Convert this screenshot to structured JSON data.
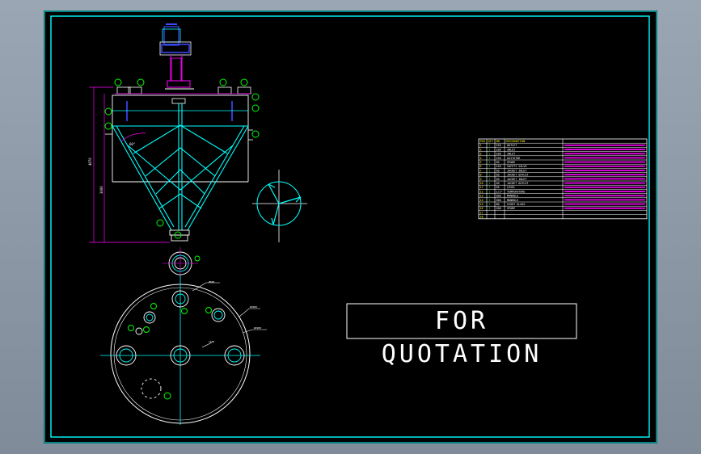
{
  "colors": {
    "background": "#000000",
    "frame": "#00ffff",
    "outline": "#ffffff",
    "magenta": "#ff00ff",
    "green": "#00ff00",
    "yellow": "#ffff00",
    "blue": "#3c4bff"
  },
  "stamp": "FOR QUOTATION",
  "bom": {
    "headers": [
      "POS",
      "QTY",
      "DN",
      "DESIGNATION"
    ],
    "rows": [
      {
        "pos": "1",
        "qty": "1",
        "dn": "250",
        "name": "OUTLET"
      },
      {
        "pos": "2",
        "qty": "1",
        "dn": "100",
        "name": "INLET"
      },
      {
        "pos": "3",
        "qty": "1",
        "dn": "100",
        "name": "INLET"
      },
      {
        "pos": "4",
        "qty": "1",
        "dn": "150",
        "name": "AGITATOR"
      },
      {
        "pos": "5",
        "qty": "1",
        "dn": "50",
        "name": "SPARE"
      },
      {
        "pos": "6",
        "qty": "1",
        "dn": "150",
        "name": "SAFETY VALVE"
      },
      {
        "pos": "7",
        "qty": "1",
        "dn": "50",
        "name": "JACKET INLET"
      },
      {
        "pos": "8",
        "qty": "1",
        "dn": "50",
        "name": "JACKET OUTLET"
      },
      {
        "pos": "9",
        "qty": "1",
        "dn": "50",
        "name": "JACKET INLET"
      },
      {
        "pos": "10",
        "qty": "1",
        "dn": "50",
        "name": "JACKET OUTLET"
      },
      {
        "pos": "11",
        "qty": "1",
        "dn": "50",
        "name": "LEVEL"
      },
      {
        "pos": "12",
        "qty": "1",
        "dn": "1/2\"",
        "name": "TEMPERATURE"
      },
      {
        "pos": "13",
        "qty": "1",
        "dn": "300",
        "name": "MANHOLE"
      },
      {
        "pos": "14",
        "qty": "1",
        "dn": "300",
        "name": "MANHOLE"
      },
      {
        "pos": "15",
        "qty": "1",
        "dn": "80",
        "name": "SIGHT GLASS"
      },
      {
        "pos": "16",
        "qty": "1",
        "dn": "200",
        "name": "SPARE"
      },
      {
        "pos": "17",
        "qty": "",
        "dn": "",
        "name": ""
      },
      {
        "pos": "18",
        "qty": "",
        "dn": "",
        "name": ""
      }
    ]
  }
}
